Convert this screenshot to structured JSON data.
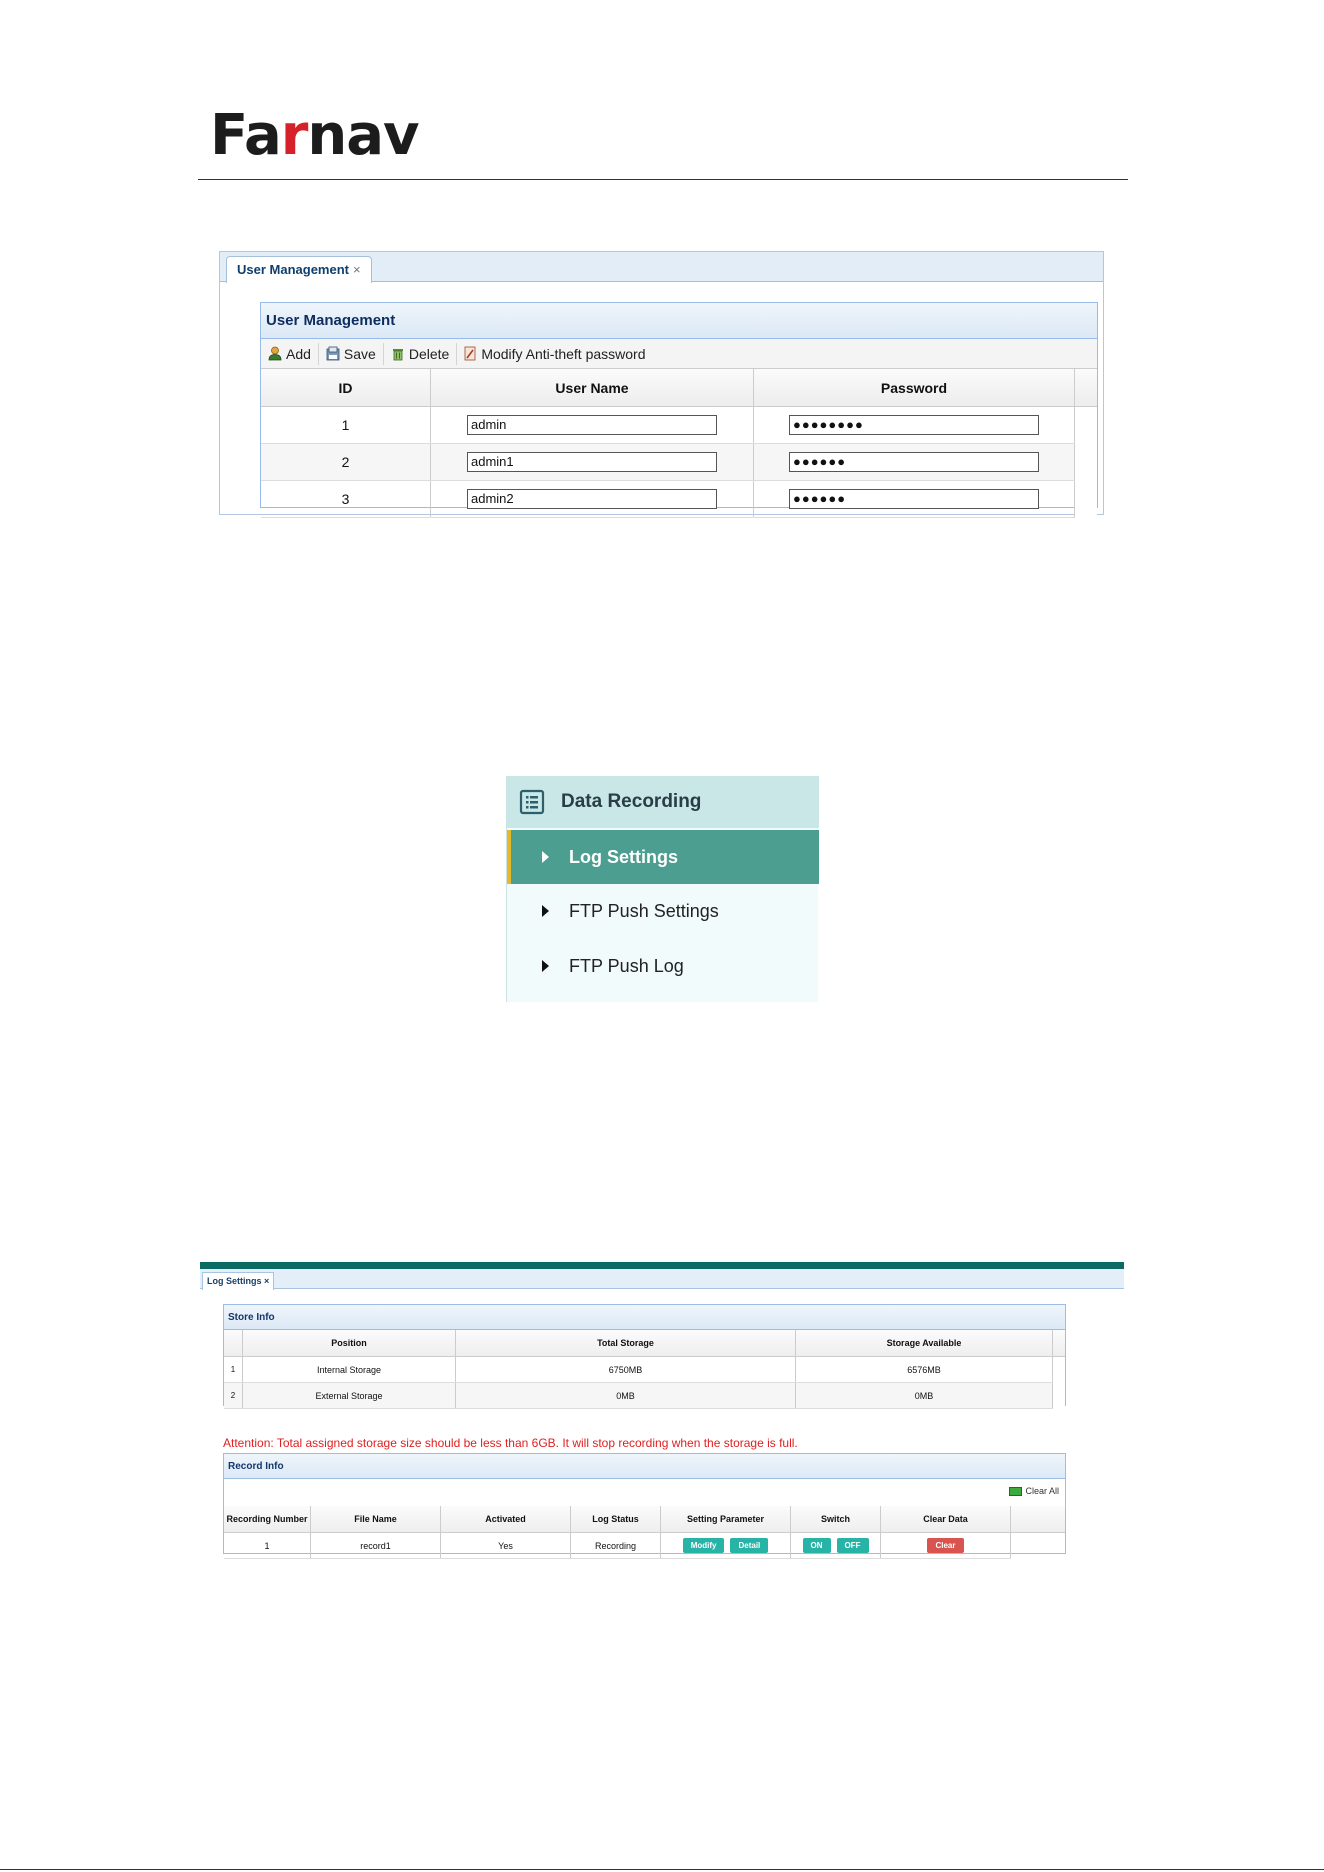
{
  "brand": {
    "logo_pre": "Fa",
    "logo_r": "r",
    "logo_post": "nav"
  },
  "user_mgmt": {
    "tab_label": "User Management",
    "tab_close": "×",
    "panel_title": "User Management",
    "toolbar": {
      "add": "Add",
      "save": "Save",
      "delete": "Delete",
      "modify": "Modify Anti-theft password"
    },
    "columns": {
      "id": "ID",
      "username": "User Name",
      "password": "Password"
    },
    "rows": [
      {
        "id": "1",
        "username": "admin",
        "password": "●●●●●●●●"
      },
      {
        "id": "2",
        "username": "admin1",
        "password": "●●●●●●"
      },
      {
        "id": "3",
        "username": "admin2",
        "password": "●●●●●●"
      }
    ]
  },
  "nav": {
    "header": "Data Recording",
    "items": [
      {
        "label": "Log Settings",
        "active": true
      },
      {
        "label": "FTP Push Settings",
        "active": false
      },
      {
        "label": "FTP Push Log",
        "active": false
      }
    ]
  },
  "log_settings": {
    "tab_label": "Log Settings",
    "tab_close": "×",
    "store": {
      "title": "Store Info",
      "columns": {
        "position": "Position",
        "total": "Total Storage",
        "available": "Storage Available"
      },
      "rows": [
        {
          "n": "1",
          "position": "Internal Storage",
          "total": "6750MB",
          "available": "6576MB"
        },
        {
          "n": "2",
          "position": "External Storage",
          "total": "0MB",
          "available": "0MB"
        }
      ]
    },
    "attention": "Attention: Total assigned storage size should be less than 6GB. It will stop recording when the storage is full.",
    "record": {
      "title": "Record Info",
      "clear_all": "Clear All",
      "columns": {
        "number": "Recording Number",
        "file": "File Name",
        "activated": "Activated",
        "status": "Log Status",
        "setting": "Setting Parameter",
        "switch": "Switch",
        "clear": "Clear Data"
      },
      "rows": [
        {
          "number": "1",
          "file": "record1",
          "activated": "Yes",
          "status": "Recording",
          "modify": "Modify",
          "detail": "Detail",
          "on": "ON",
          "off": "OFF",
          "clear": "Clear"
        }
      ]
    }
  },
  "colors": {
    "teal": "#27b3a6",
    "nav_active": "#4c9f90",
    "attention": "#e02020",
    "brand_red": "#d6212a"
  }
}
